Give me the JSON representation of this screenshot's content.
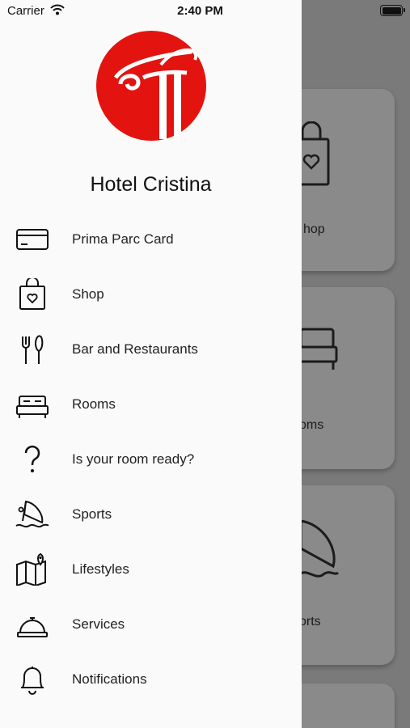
{
  "status_bar": {
    "carrier": "Carrier",
    "time": "2:40 PM"
  },
  "drawer": {
    "hotel_name": "Hotel Cristina",
    "brand_color": "#e3140f",
    "items": [
      {
        "label": "Prima Parc Card",
        "icon": "card-icon"
      },
      {
        "label": "Shop",
        "icon": "shopping-bag-icon"
      },
      {
        "label": "Bar and Restaurants",
        "icon": "fork-knife-icon"
      },
      {
        "label": "Rooms",
        "icon": "bed-icon"
      },
      {
        "label": "Is your room ready?",
        "icon": "question-icon"
      },
      {
        "label": "Sports",
        "icon": "windsurf-icon"
      },
      {
        "label": "Lifestyles",
        "icon": "map-icon"
      },
      {
        "label": "Services",
        "icon": "service-bell-icon"
      },
      {
        "label": "Notifications",
        "icon": "bell-icon"
      }
    ]
  },
  "background": {
    "cards": [
      {
        "label": "hop"
      },
      {
        "label": "oms"
      },
      {
        "label": "orts"
      }
    ]
  }
}
